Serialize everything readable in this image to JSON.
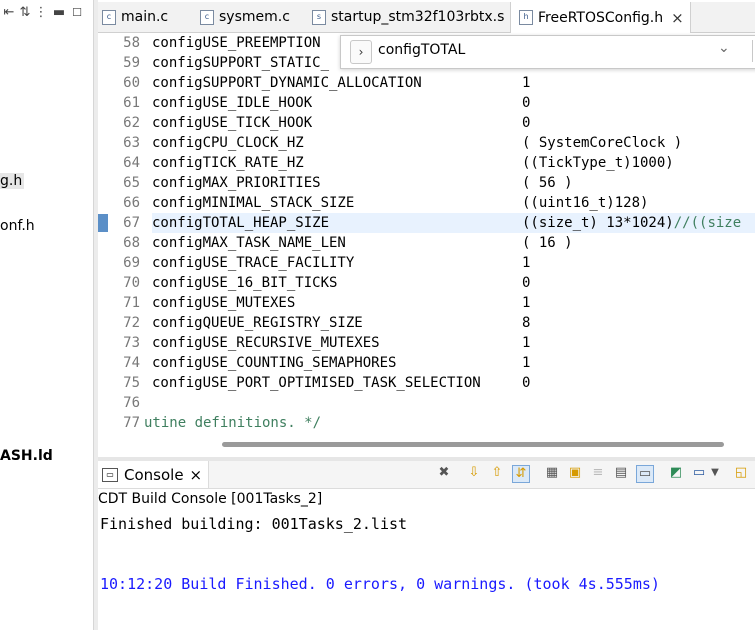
{
  "explorer": {
    "toolbar_icons": [
      "collapse-all-icon",
      "link-editor-icon",
      "view-menu-icon",
      "minimize-icon",
      "maximize-icon"
    ],
    "items": [
      "g.h",
      "onf.h",
      "ASH.ld"
    ]
  },
  "tabs": [
    {
      "label": "main.c",
      "icon": "c-file-icon",
      "active": false
    },
    {
      "label": "sysmem.c",
      "icon": "c-file-icon",
      "active": false
    },
    {
      "label": "startup_stm32f103rbtx.s",
      "icon": "asm-file-icon",
      "active": false
    },
    {
      "label": "FreeRTOSConfig.h",
      "icon": "h-file-icon",
      "active": true,
      "close": "×"
    }
  ],
  "search": {
    "chevron": "›",
    "query": "configTOTAL",
    "dropdown": "⌄"
  },
  "editor": {
    "lines": [
      {
        "num": "58",
        "code": "configUSE_PREEMPTION",
        "value": ""
      },
      {
        "num": "59",
        "code": "configSUPPORT_STATIC_",
        "value": ""
      },
      {
        "num": "60",
        "code": "configSUPPORT_DYNAMIC_ALLOCATION",
        "value": "1"
      },
      {
        "num": "61",
        "code": "configUSE_IDLE_HOOK",
        "value": "0"
      },
      {
        "num": "62",
        "code": "configUSE_TICK_HOOK",
        "value": "0"
      },
      {
        "num": "63",
        "code": "configCPU_CLOCK_HZ",
        "value": "( SystemCoreClock )"
      },
      {
        "num": "64",
        "code": "configTICK_RATE_HZ",
        "value": "((TickType_t)1000)"
      },
      {
        "num": "65",
        "code": "configMAX_PRIORITIES",
        "value": "( 56 )"
      },
      {
        "num": "66",
        "code": "configMINIMAL_STACK_SIZE",
        "value": "((uint16_t)128)"
      },
      {
        "num": "67",
        "code": "configTOTAL_HEAP_SIZE",
        "value": "((size_t) 13*1024)",
        "comment": "//((size"
      },
      {
        "num": "68",
        "code": "configMAX_TASK_NAME_LEN",
        "value": "( 16 )"
      },
      {
        "num": "69",
        "code": "configUSE_TRACE_FACILITY",
        "value": "1"
      },
      {
        "num": "70",
        "code": "configUSE_16_BIT_TICKS",
        "value": "0"
      },
      {
        "num": "71",
        "code": "configUSE_MUTEXES",
        "value": "1"
      },
      {
        "num": "72",
        "code": "configQUEUE_REGISTRY_SIZE",
        "value": "8"
      },
      {
        "num": "73",
        "code": "configUSE_RECURSIVE_MUTEXES",
        "value": "1"
      },
      {
        "num": "74",
        "code": "configUSE_COUNTING_SEMAPHORES",
        "value": "1"
      },
      {
        "num": "75",
        "code": "configUSE_PORT_OPTIMISED_TASK_SELECTION",
        "value": "0"
      },
      {
        "num": "76",
        "code": "",
        "value": ""
      },
      {
        "num": "77",
        "code": "",
        "value": "",
        "comment_line": "utine definitions. */"
      }
    ]
  },
  "console": {
    "tab_label": "Console",
    "tab_close": "×",
    "title": "CDT Build Console [001Tasks_2]",
    "lines": [
      {
        "text": "Finished building: 001Tasks_2.list",
        "color": "#000000"
      },
      {
        "text": "10:12:20 Build Finished. 0 errors, 0 warnings. (took 4s.555ms)",
        "color": "#1a1aff"
      }
    ],
    "toolbar_icons": [
      "remove-launch-icon",
      "previous-icon",
      "next-icon",
      "scroll-lock-icon",
      "word-wrap-icon",
      "show-on-output-icon",
      "clear-console-icon",
      "pin-console-icon",
      "copy-icon",
      "open-console-icon",
      "display-console-icon",
      "new-console-icon"
    ]
  }
}
